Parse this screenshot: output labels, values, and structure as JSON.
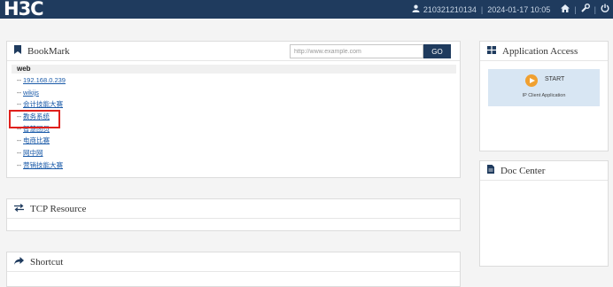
{
  "header": {
    "logo": "H3C",
    "user": "210321210134",
    "separator": "|",
    "datetime": "2024-01-17 10:05",
    "icons": [
      "user-icon",
      "home-icon",
      "wrench-icon",
      "power-icon"
    ]
  },
  "bookmark": {
    "title": "BookMark",
    "icon": "bookmark-icon",
    "search_placeholder": "http://www.example.com",
    "go_label": "GO",
    "group": "web",
    "items": [
      {
        "dash": "--",
        "label": "192.168.0.239"
      },
      {
        "dash": "--",
        "label": "wikijs"
      },
      {
        "dash": "--",
        "label": "会计技能大赛"
      },
      {
        "dash": "--",
        "label": "教务系统"
      },
      {
        "dash": "--",
        "label": "智慧团员"
      },
      {
        "dash": "--",
        "label": "电商比赛"
      },
      {
        "dash": "--",
        "label": "网中网"
      },
      {
        "dash": "--",
        "label": "营销技能大赛"
      }
    ],
    "highlight_color": "#e0201c"
  },
  "tcp": {
    "title": "TCP Resource",
    "icon": "exchange-icon"
  },
  "shortcut": {
    "title": "Shortcut",
    "icon": "share-icon"
  },
  "app_access": {
    "title": "Application Access",
    "icon": "grid-icon",
    "tile": {
      "start_label": "START",
      "client_label": "IP Client Application",
      "icon": "play-icon"
    }
  },
  "doc_center": {
    "title": "Doc Center",
    "icon": "document-icon"
  },
  "colors": {
    "header_bg": "#1f3b5e",
    "accent": "#1f3b5e",
    "link": "#1a5aa8",
    "tile_bg": "#d8e6f3",
    "play": "#f0a030"
  }
}
